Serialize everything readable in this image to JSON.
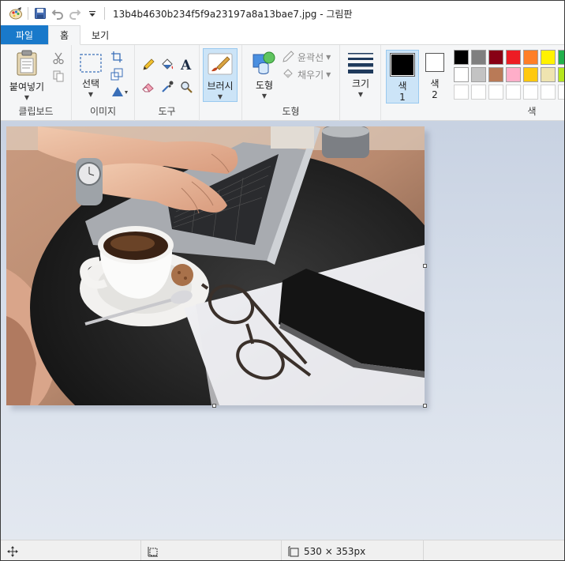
{
  "window": {
    "title": "13b4b4630b234f5f9a23197a8a13bae7.jpg - 그림판"
  },
  "tabs": [
    {
      "label": "파일"
    },
    {
      "label": "홈"
    },
    {
      "label": "보기"
    }
  ],
  "ribbon": {
    "clipboard": {
      "group_label": "클립보드",
      "paste_label": "붙여넣기"
    },
    "image": {
      "group_label": "이미지",
      "select_label": "선택"
    },
    "tools": {
      "group_label": "도구"
    },
    "brushes": {
      "label": "브러시"
    },
    "shapes": {
      "group_label": "도형",
      "shapes_label": "도형",
      "outline_label": "윤곽선",
      "fill_label": "채우기"
    },
    "size": {
      "label": "크기"
    },
    "color1": {
      "label_line1": "색",
      "label_line2": "1",
      "value": "#000000"
    },
    "color2": {
      "label_line1": "색",
      "label_line2": "2",
      "value": "#ffffff"
    },
    "colors": {
      "group_label": "색",
      "palette_row1": [
        "#000000",
        "#7f7f7f",
        "#880015",
        "#ed1c24",
        "#ff7f27",
        "#fff200",
        "#22b14c"
      ],
      "palette_row2": [
        "#ffffff",
        "#c3c3c3",
        "#b97a57",
        "#ffaec9",
        "#ffc90e",
        "#efe4b0",
        "#b5e61d"
      ]
    }
  },
  "image": {
    "description_icon": "photo-laptop-coffee-glasses"
  },
  "statusbar": {
    "image_size": "530 × 353px"
  }
}
